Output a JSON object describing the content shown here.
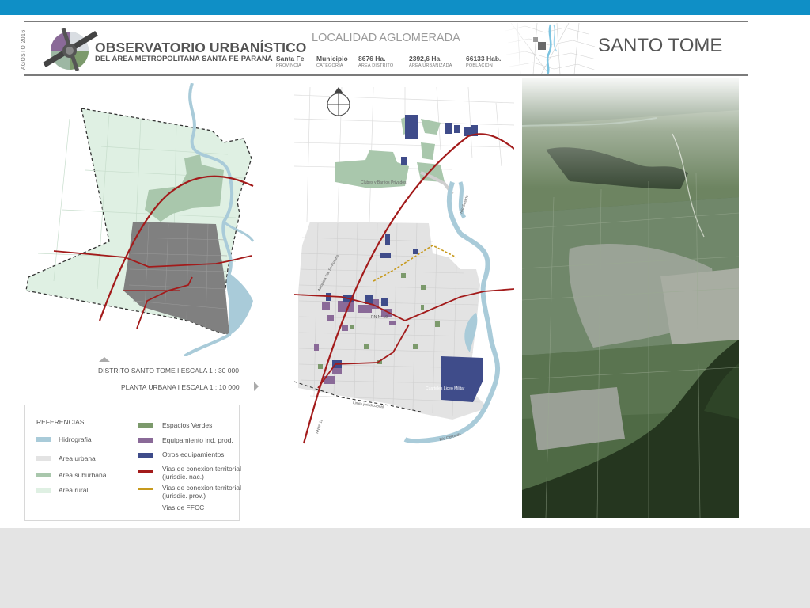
{
  "header": {
    "date_vertical": "AGOSTO 2016",
    "logo_name": "observatorio-logo",
    "org_title": "OBSERVATORIO URBANÍSTICO",
    "org_subtitle": "DEL ÁREA METROPOLITANA SANTA FE-PARANÁ",
    "locality_type": "LOCALIDAD AGLOMERADA",
    "city_name": "SANTO TOME",
    "stats": [
      {
        "value": "Santa Fe",
        "label": "PROVINCIA"
      },
      {
        "value": "Municipio",
        "label": "CATEGORIA"
      },
      {
        "value": "8676 Ha.",
        "label": "AREA DISTRITO"
      },
      {
        "value": "2392,6 Ha.",
        "label": "AREA URBANIZADA"
      },
      {
        "value": "66133 Hab.",
        "label": "POBLACION"
      }
    ]
  },
  "colors": {
    "topbar": "#0f8fc6",
    "hidrografia": "#a9cbd9",
    "area_urbana": "#e3e3e3",
    "area_suburbana": "#a9c7ac",
    "area_rural": "#dff0e3",
    "espacios_verdes": "#7c9a6c",
    "equipamiento_ind": "#8a6a98",
    "otros_equipamientos": "#3f4c8a",
    "vias_nac": "#a31b1b",
    "vias_prov": "#c79a1d",
    "vias_ffcc": "#b9b59a"
  },
  "maps": {
    "district_scale": "DISTRITO SANTO TOME I ESCALA  1 : 30 000",
    "urban_scale": "PLANTA URBANA I ESCALA  1 : 10 000",
    "labels": {
      "clubes": "Clubes y Barrios Privados",
      "rio_salado": "Rio Salado",
      "rp_19": "RN Nº 19",
      "autopista": "Autopista Sta. Fe-Rosario",
      "rn_11": "RN Nº 11",
      "limite": "Limite jurisdiccional",
      "cuarteles": "Cuarteles Liceo Militar",
      "rio_coronda": "Rio Coronda"
    }
  },
  "legend": {
    "title": "REFERENCIAS",
    "left": [
      "Hidrografia",
      "Area urbana",
      "Area suburbana",
      "Area rural"
    ],
    "right": [
      "Espacios Verdes",
      "Equipamiento ind. prod.",
      "Otros equipamientos",
      "Vias de conexion territorial",
      "(jurisdic. nac.)",
      "Vias de conexion territorial",
      "(jurisdic. prov.)",
      "Vias de FFCC"
    ]
  }
}
